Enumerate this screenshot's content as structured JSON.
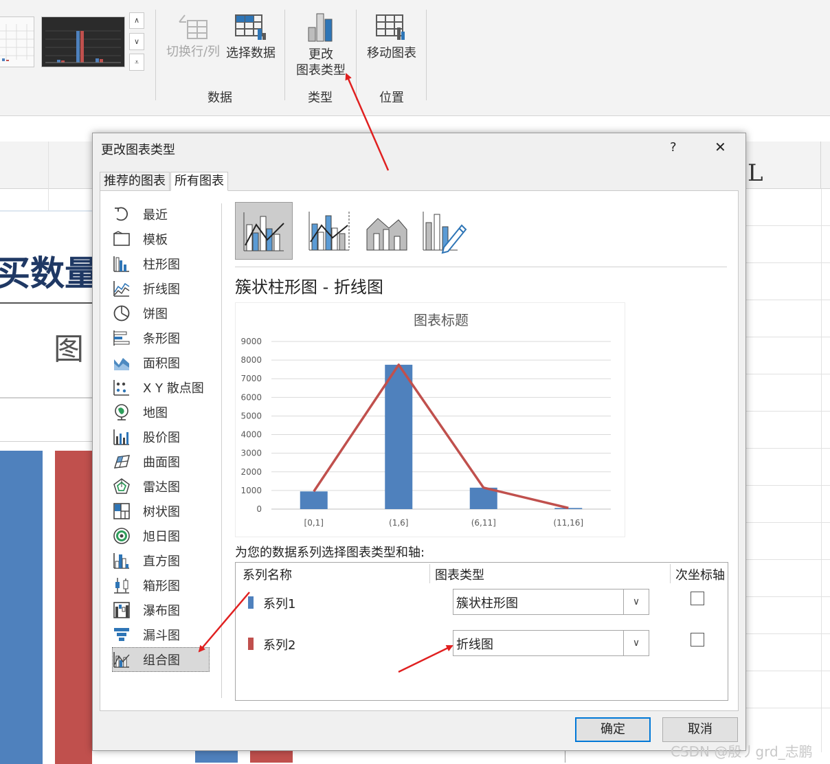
{
  "ribbon": {
    "switch_row_col": "切换行/列",
    "select_data": "选择数据",
    "change_type_line1": "更改",
    "change_type_line2": "图表类型",
    "move_chart": "移动图表",
    "group_data": "数据",
    "group_type": "类型",
    "group_location": "位置"
  },
  "sheet": {
    "column_letter": "L",
    "heading_fragment": "买数量",
    "subheading_fragment": "图"
  },
  "dialog": {
    "title": "更改图表类型",
    "help": "?",
    "close": "✕",
    "tabs": [
      "推荐的图表",
      "所有图表"
    ],
    "nav_items": [
      {
        "label": "最近",
        "icon": "recent-icon"
      },
      {
        "label": "模板",
        "icon": "template-icon"
      },
      {
        "label": "柱形图",
        "icon": "column-chart-icon"
      },
      {
        "label": "折线图",
        "icon": "line-chart-icon"
      },
      {
        "label": "饼图",
        "icon": "pie-chart-icon"
      },
      {
        "label": "条形图",
        "icon": "bar-chart-icon"
      },
      {
        "label": "面积图",
        "icon": "area-chart-icon"
      },
      {
        "label": "X Y 散点图",
        "icon": "scatter-chart-icon"
      },
      {
        "label": "地图",
        "icon": "map-chart-icon"
      },
      {
        "label": "股价图",
        "icon": "stock-chart-icon"
      },
      {
        "label": "曲面图",
        "icon": "surface-chart-icon"
      },
      {
        "label": "雷达图",
        "icon": "radar-chart-icon"
      },
      {
        "label": "树状图",
        "icon": "treemap-chart-icon"
      },
      {
        "label": "旭日图",
        "icon": "sunburst-chart-icon"
      },
      {
        "label": "直方图",
        "icon": "histogram-chart-icon"
      },
      {
        "label": "箱形图",
        "icon": "box-chart-icon"
      },
      {
        "label": "瀑布图",
        "icon": "waterfall-chart-icon"
      },
      {
        "label": "漏斗图",
        "icon": "funnel-chart-icon"
      },
      {
        "label": "组合图",
        "icon": "combo-chart-icon"
      }
    ],
    "subtype_title": "簇状柱形图 - 折线图",
    "series_prompt": "为您的数据系列选择图表类型和轴:",
    "series_headers": {
      "name": "系列名称",
      "type": "图表类型",
      "secondary": "次坐标轴"
    },
    "series": [
      {
        "name": "系列1",
        "type": "簇状柱形图",
        "secondary": false,
        "color": "#4f81bd"
      },
      {
        "name": "系列2",
        "type": "折线图",
        "secondary": false,
        "color": "#c0504d"
      }
    ],
    "ok": "确定",
    "cancel": "取消"
  },
  "chart_data": {
    "type": "bar",
    "title": "图表标题",
    "categories": [
      "[0,1]",
      "(1,6]",
      "(6,11]",
      "(11,16]"
    ],
    "series": [
      {
        "name": "系列1",
        "type": "bar",
        "values": [
          950,
          7750,
          1150,
          60
        ],
        "color": "#4f81bd"
      },
      {
        "name": "系列2",
        "type": "line",
        "values": [
          950,
          7750,
          1150,
          60
        ],
        "color": "#c0504d"
      }
    ],
    "ylim": [
      0,
      9000
    ],
    "yticks": [
      0,
      1000,
      2000,
      3000,
      4000,
      5000,
      6000,
      7000,
      8000,
      9000
    ],
    "grid": true
  },
  "watermark": "CSDN @殷丿grd_志鹏",
  "colors": {
    "accent": "#0078d7",
    "annotation_arrow": "#e02020"
  }
}
